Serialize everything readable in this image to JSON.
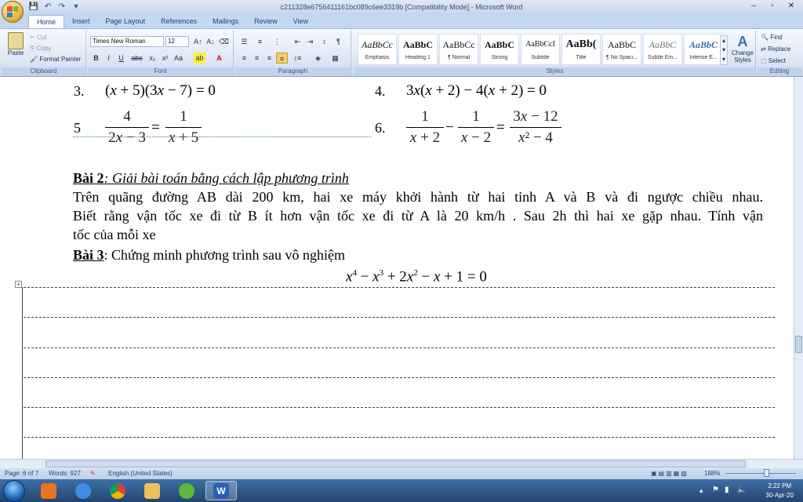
{
  "window": {
    "title": "c211328e6756411161bc089c6ee3319b [Compatibility Mode] - Microsoft Word",
    "minimize": "–",
    "maximize": "▫",
    "close": "✕"
  },
  "tabs": [
    "Home",
    "Insert",
    "Page Layout",
    "References",
    "Mailings",
    "Review",
    "View"
  ],
  "ribbon": {
    "clipboard": {
      "paste": "Paste",
      "cut": "Cut",
      "copy": "Copy",
      "format_painter": "Format Painter",
      "label": "Clipboard"
    },
    "font": {
      "family": "Times New Roman",
      "size": "12",
      "label": "Font"
    },
    "paragraph": {
      "label": "Paragraph"
    },
    "styles": {
      "label": "Styles",
      "items": [
        {
          "sample": "AaBbCc",
          "name": "Emphasis"
        },
        {
          "sample": "AaBbC",
          "name": "Heading 1"
        },
        {
          "sample": "AaBbCc",
          "name": "¶ Normal"
        },
        {
          "sample": "AaBbC",
          "name": "Strong"
        },
        {
          "sample": "AaBbCcI",
          "name": "Subtitle"
        },
        {
          "sample": "AaBb(",
          "name": "Title"
        },
        {
          "sample": "AaBbC",
          "name": "¶ No Spaci..."
        },
        {
          "sample": "AaBbC",
          "name": "Subtle Em..."
        },
        {
          "sample": "AaBbC",
          "name": "Intense E..."
        }
      ],
      "change_styles": "Change Styles"
    },
    "editing": {
      "find": "Find",
      "replace": "Replace",
      "select": "Select",
      "label": "Editing"
    }
  },
  "document": {
    "eq3_num": "3.",
    "eq4_num": "4.",
    "eq5_num": "5",
    "eq6_num": "6.",
    "bai2_title": "Bài 2",
    "bai2_subtitle": ": Giải bài toán bằng cách lập phương trình",
    "bai2_line1": "Trên quãng đường AB dài 200 km, hai xe máy khởi hành từ hai tỉnh A và B và đi ngược chiều nhau.",
    "bai2_line2": "Biết rằng vận tốc xe đi từ B ít hơn vận tốc xe đi từ A là 20 km/h . Sau 2h thì hai xe gặp nhau. Tính vận",
    "bai2_line3": "tốc của mỗi xe",
    "bai3_title": "Bài 3",
    "bai3_text": ": Chứng minh phương trình sau vô nghiệm"
  },
  "status": {
    "page": "Page: 6 of 7",
    "words": "Words: 927",
    "language": "English (United States)",
    "zoom": "188%"
  },
  "taskbar": {
    "time": "2:22 PM",
    "date": "30-Apr-20"
  }
}
